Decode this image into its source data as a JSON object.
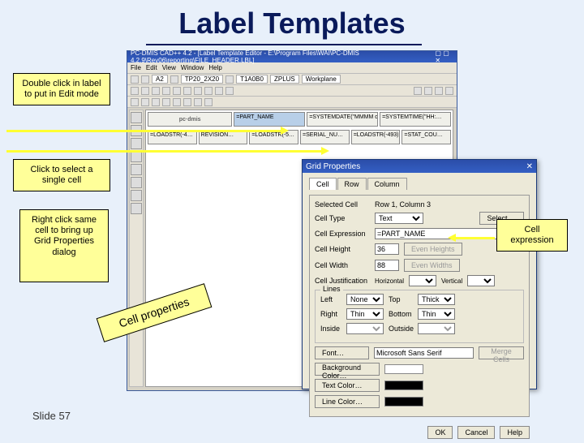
{
  "title": "Label Templates",
  "slide": "Slide 57",
  "callouts": {
    "c1": "Double click in label to put in Edit mode",
    "c2": "Click to select a single cell",
    "c3": "Right click same cell to bring up Grid Properties dialog",
    "c4": "Cell expression",
    "rot": "Cell properties"
  },
  "app": {
    "title": "PC-DMIS CAD++ 4.2 - [Label Template Editor - E:\\Program Files\\WAI\\PC-DMIS 4.2.9\\Rev06\\reporting\\FILE_HEADER.LBL]",
    "menus": [
      "File",
      "Edit",
      "View",
      "Window",
      "Help"
    ],
    "tb_text": [
      "A2",
      "TP20_2X20",
      "T1A0B0",
      "ZPLUS",
      "Workplane"
    ],
    "logo": "pc·dmis",
    "row1": [
      "",
      "=PART_NAME",
      "=SYSTEMDATE(\"MMMM dd, yyyy\")",
      "=SYSTEMTIME(\"HH:…"
    ],
    "row2": [
      "=LOADSTR(-4…",
      "REVISION…",
      "=LOADSTR(-5…",
      "=SERIAL_NU…",
      "=LOADSTR(-493)",
      "=STAT_COU…"
    ]
  },
  "dlg": {
    "title": "Grid Properties",
    "tabs": [
      "Cell",
      "Row",
      "Column"
    ],
    "selected_cell_label": "Selected Cell",
    "selected_cell_value": "Row 1, Column 3",
    "cell_type_label": "Cell Type",
    "cell_type_value": "Text",
    "select_btn": "Select …",
    "cell_expr_label": "Cell Expression",
    "cell_expr_value": "=PART_NAME",
    "cell_height_label": "Cell Height",
    "cell_height_value": "36",
    "even_h": "Even Heights",
    "cell_width_label": "Cell Width",
    "cell_width_value": "88",
    "even_w": "Even Widths",
    "justh_label": "Horizontal",
    "justv_label": "Vertical",
    "just_label": "Cell Justification",
    "lines_legend": "Lines",
    "left_l": "Left",
    "left_v": "None",
    "right_l": "Right",
    "right_v": "Thin",
    "top_l": "Top",
    "top_v": "Thick",
    "bottom_l": "Bottom",
    "bottom_v": "Thin",
    "inside_l": "Inside",
    "outside_l": "Outside",
    "font_label": "Font…",
    "font_value": "Microsoft Sans Serif",
    "bg_label": "Background Color…",
    "txt_label": "Text Color…",
    "line_label": "Line Color…",
    "merge_btn": "Merge Cells",
    "colors": {
      "bg": "#ffffff",
      "txt": "#000000",
      "line": "#000000"
    },
    "ok": "OK",
    "cancel": "Cancel",
    "help": "Help"
  }
}
